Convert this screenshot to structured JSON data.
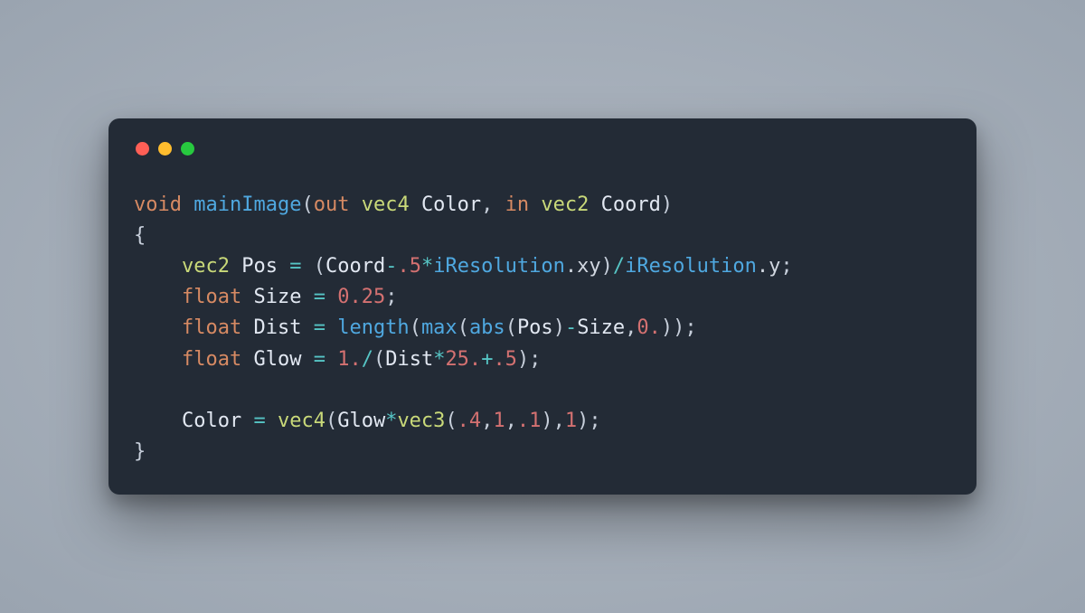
{
  "colors": {
    "window_bg": "#232b36",
    "page_bg_inner": "#b2bac4",
    "page_bg_outer": "#9aa4b0",
    "traffic_red": "#ff5f56",
    "traffic_yellow": "#ffbd2e",
    "traffic_green": "#27c93f",
    "tok_keyword": "#d78a63",
    "tok_function": "#4fa8e0",
    "tok_type": "#c9d979",
    "tok_identifier": "#e2e8f2",
    "tok_number": "#d47171",
    "tok_operator": "#56c5c5",
    "tok_default": "#c7cfdb"
  },
  "code": {
    "plain": "void mainImage(out vec4 Color, in vec2 Coord)\n{\n    vec2 Pos = (Coord-.5*iResolution.xy)/iResolution.y;\n    float Size = 0.25;\n    float Dist = length(max(abs(Pos)-Size,0.));\n    float Glow = 1./(Dist*25.+.5);\n\n    Color = vec4(Glow*vec3(.4,1,.1),1);\n}",
    "lines": [
      [
        {
          "t": "void",
          "c": "kw"
        },
        {
          "t": " ",
          "c": "punc"
        },
        {
          "t": "mainImage",
          "c": "fn"
        },
        {
          "t": "(",
          "c": "punc"
        },
        {
          "t": "out",
          "c": "kw"
        },
        {
          "t": " ",
          "c": "punc"
        },
        {
          "t": "vec4",
          "c": "type"
        },
        {
          "t": " ",
          "c": "punc"
        },
        {
          "t": "Color",
          "c": "id"
        },
        {
          "t": ", ",
          "c": "punc"
        },
        {
          "t": "in",
          "c": "kw"
        },
        {
          "t": " ",
          "c": "punc"
        },
        {
          "t": "vec2",
          "c": "type"
        },
        {
          "t": " ",
          "c": "punc"
        },
        {
          "t": "Coord",
          "c": "id"
        },
        {
          "t": ")",
          "c": "punc"
        }
      ],
      [
        {
          "t": "{",
          "c": "punc"
        }
      ],
      [
        {
          "t": "    ",
          "c": "punc"
        },
        {
          "t": "vec2",
          "c": "type"
        },
        {
          "t": " ",
          "c": "punc"
        },
        {
          "t": "Pos",
          "c": "id"
        },
        {
          "t": " ",
          "c": "punc"
        },
        {
          "t": "=",
          "c": "op"
        },
        {
          "t": " (",
          "c": "punc"
        },
        {
          "t": "Coord",
          "c": "id"
        },
        {
          "t": "-",
          "c": "op"
        },
        {
          "t": ".5",
          "c": "num"
        },
        {
          "t": "*",
          "c": "op"
        },
        {
          "t": "iResolution",
          "c": "fn"
        },
        {
          "t": ".xy",
          "c": "prop"
        },
        {
          "t": ")",
          "c": "punc"
        },
        {
          "t": "/",
          "c": "op"
        },
        {
          "t": "iResolution",
          "c": "fn"
        },
        {
          "t": ".y",
          "c": "prop"
        },
        {
          "t": ";",
          "c": "punc"
        }
      ],
      [
        {
          "t": "    ",
          "c": "punc"
        },
        {
          "t": "float",
          "c": "kw"
        },
        {
          "t": " ",
          "c": "punc"
        },
        {
          "t": "Size",
          "c": "id"
        },
        {
          "t": " ",
          "c": "punc"
        },
        {
          "t": "=",
          "c": "op"
        },
        {
          "t": " ",
          "c": "punc"
        },
        {
          "t": "0.25",
          "c": "num"
        },
        {
          "t": ";",
          "c": "punc"
        }
      ],
      [
        {
          "t": "    ",
          "c": "punc"
        },
        {
          "t": "float",
          "c": "kw"
        },
        {
          "t": " ",
          "c": "punc"
        },
        {
          "t": "Dist",
          "c": "id"
        },
        {
          "t": " ",
          "c": "punc"
        },
        {
          "t": "=",
          "c": "op"
        },
        {
          "t": " ",
          "c": "punc"
        },
        {
          "t": "length",
          "c": "fn"
        },
        {
          "t": "(",
          "c": "punc"
        },
        {
          "t": "max",
          "c": "fn"
        },
        {
          "t": "(",
          "c": "punc"
        },
        {
          "t": "abs",
          "c": "fn"
        },
        {
          "t": "(",
          "c": "punc"
        },
        {
          "t": "Pos",
          "c": "id"
        },
        {
          "t": ")",
          "c": "punc"
        },
        {
          "t": "-",
          "c": "op"
        },
        {
          "t": "Size",
          "c": "id"
        },
        {
          "t": ",",
          "c": "punc"
        },
        {
          "t": "0.",
          "c": "num"
        },
        {
          "t": "));",
          "c": "punc"
        }
      ],
      [
        {
          "t": "    ",
          "c": "punc"
        },
        {
          "t": "float",
          "c": "kw"
        },
        {
          "t": " ",
          "c": "punc"
        },
        {
          "t": "Glow",
          "c": "id"
        },
        {
          "t": " ",
          "c": "punc"
        },
        {
          "t": "=",
          "c": "op"
        },
        {
          "t": " ",
          "c": "punc"
        },
        {
          "t": "1.",
          "c": "num"
        },
        {
          "t": "/",
          "c": "op"
        },
        {
          "t": "(",
          "c": "punc"
        },
        {
          "t": "Dist",
          "c": "id"
        },
        {
          "t": "*",
          "c": "op"
        },
        {
          "t": "25.",
          "c": "num"
        },
        {
          "t": "+",
          "c": "op"
        },
        {
          "t": ".5",
          "c": "num"
        },
        {
          "t": ");",
          "c": "punc"
        }
      ],
      [],
      [
        {
          "t": "    ",
          "c": "punc"
        },
        {
          "t": "Color",
          "c": "id"
        },
        {
          "t": " ",
          "c": "punc"
        },
        {
          "t": "=",
          "c": "op"
        },
        {
          "t": " ",
          "c": "punc"
        },
        {
          "t": "vec4",
          "c": "type"
        },
        {
          "t": "(",
          "c": "punc"
        },
        {
          "t": "Glow",
          "c": "id"
        },
        {
          "t": "*",
          "c": "op"
        },
        {
          "t": "vec3",
          "c": "type"
        },
        {
          "t": "(",
          "c": "punc"
        },
        {
          "t": ".4",
          "c": "num"
        },
        {
          "t": ",",
          "c": "punc"
        },
        {
          "t": "1",
          "c": "num"
        },
        {
          "t": ",",
          "c": "punc"
        },
        {
          "t": ".1",
          "c": "num"
        },
        {
          "t": "),",
          "c": "punc"
        },
        {
          "t": "1",
          "c": "num"
        },
        {
          "t": ");",
          "c": "punc"
        }
      ],
      [
        {
          "t": "}",
          "c": "punc"
        }
      ]
    ]
  }
}
